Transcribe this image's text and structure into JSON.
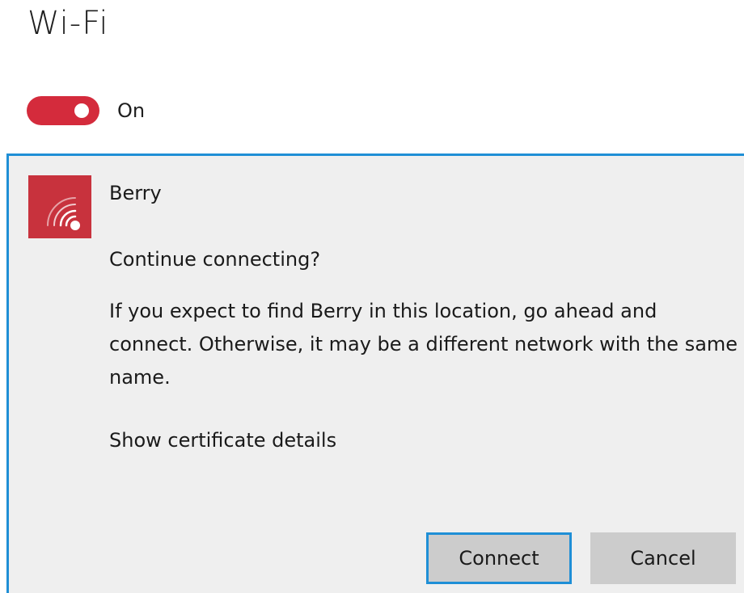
{
  "header": {
    "title": "Wi-Fi"
  },
  "wifi_toggle": {
    "state_label": "On",
    "on": true,
    "accent_color": "#d42b3c"
  },
  "network": {
    "name": "Berry",
    "icon": "wifi-signal-icon",
    "tile_color": "#c8323d"
  },
  "prompt": {
    "question": "Continue connecting?",
    "message": "If you expect to find Berry in this location, go ahead and connect. Otherwise, it may be a different network with the same name.",
    "certificate_link": "Show certificate details"
  },
  "buttons": {
    "connect": "Connect",
    "cancel": "Cancel"
  },
  "focus_color": "#1f8fd6"
}
